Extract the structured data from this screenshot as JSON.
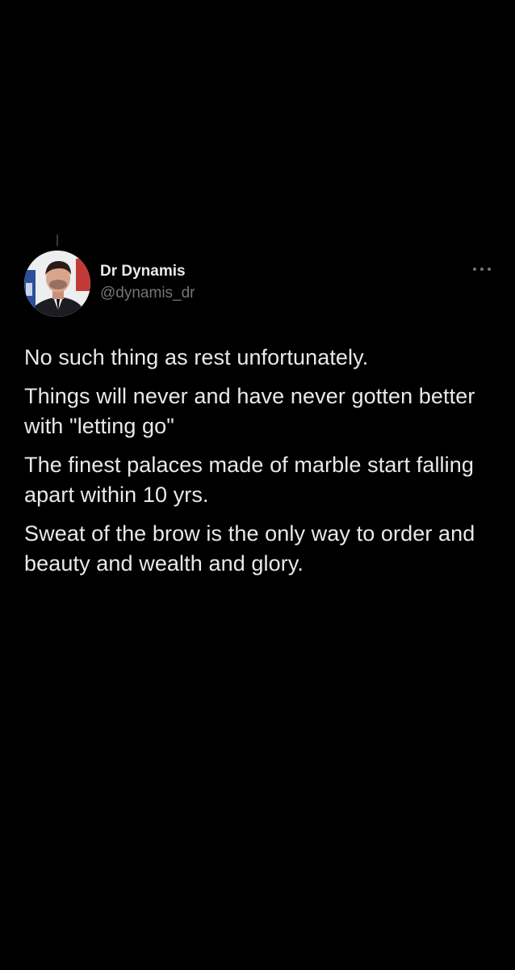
{
  "tweet": {
    "author": {
      "display_name": "Dr Dynamis",
      "handle": "@dynamis_dr",
      "avatar_icon": "profile-photo"
    },
    "more_icon": "more-options-icon",
    "paragraphs": [
      "No such thing as rest unfortunately.",
      "Things will never and have never gotten better with \"letting go\"",
      "The finest palaces made of marble start falling apart within 10 yrs.",
      "Sweat of the brow is the only way to order and beauty and wealth and glory."
    ]
  },
  "colors": {
    "background": "#000000",
    "primary_text": "#e7e9ea",
    "secondary_text": "#71767b"
  }
}
